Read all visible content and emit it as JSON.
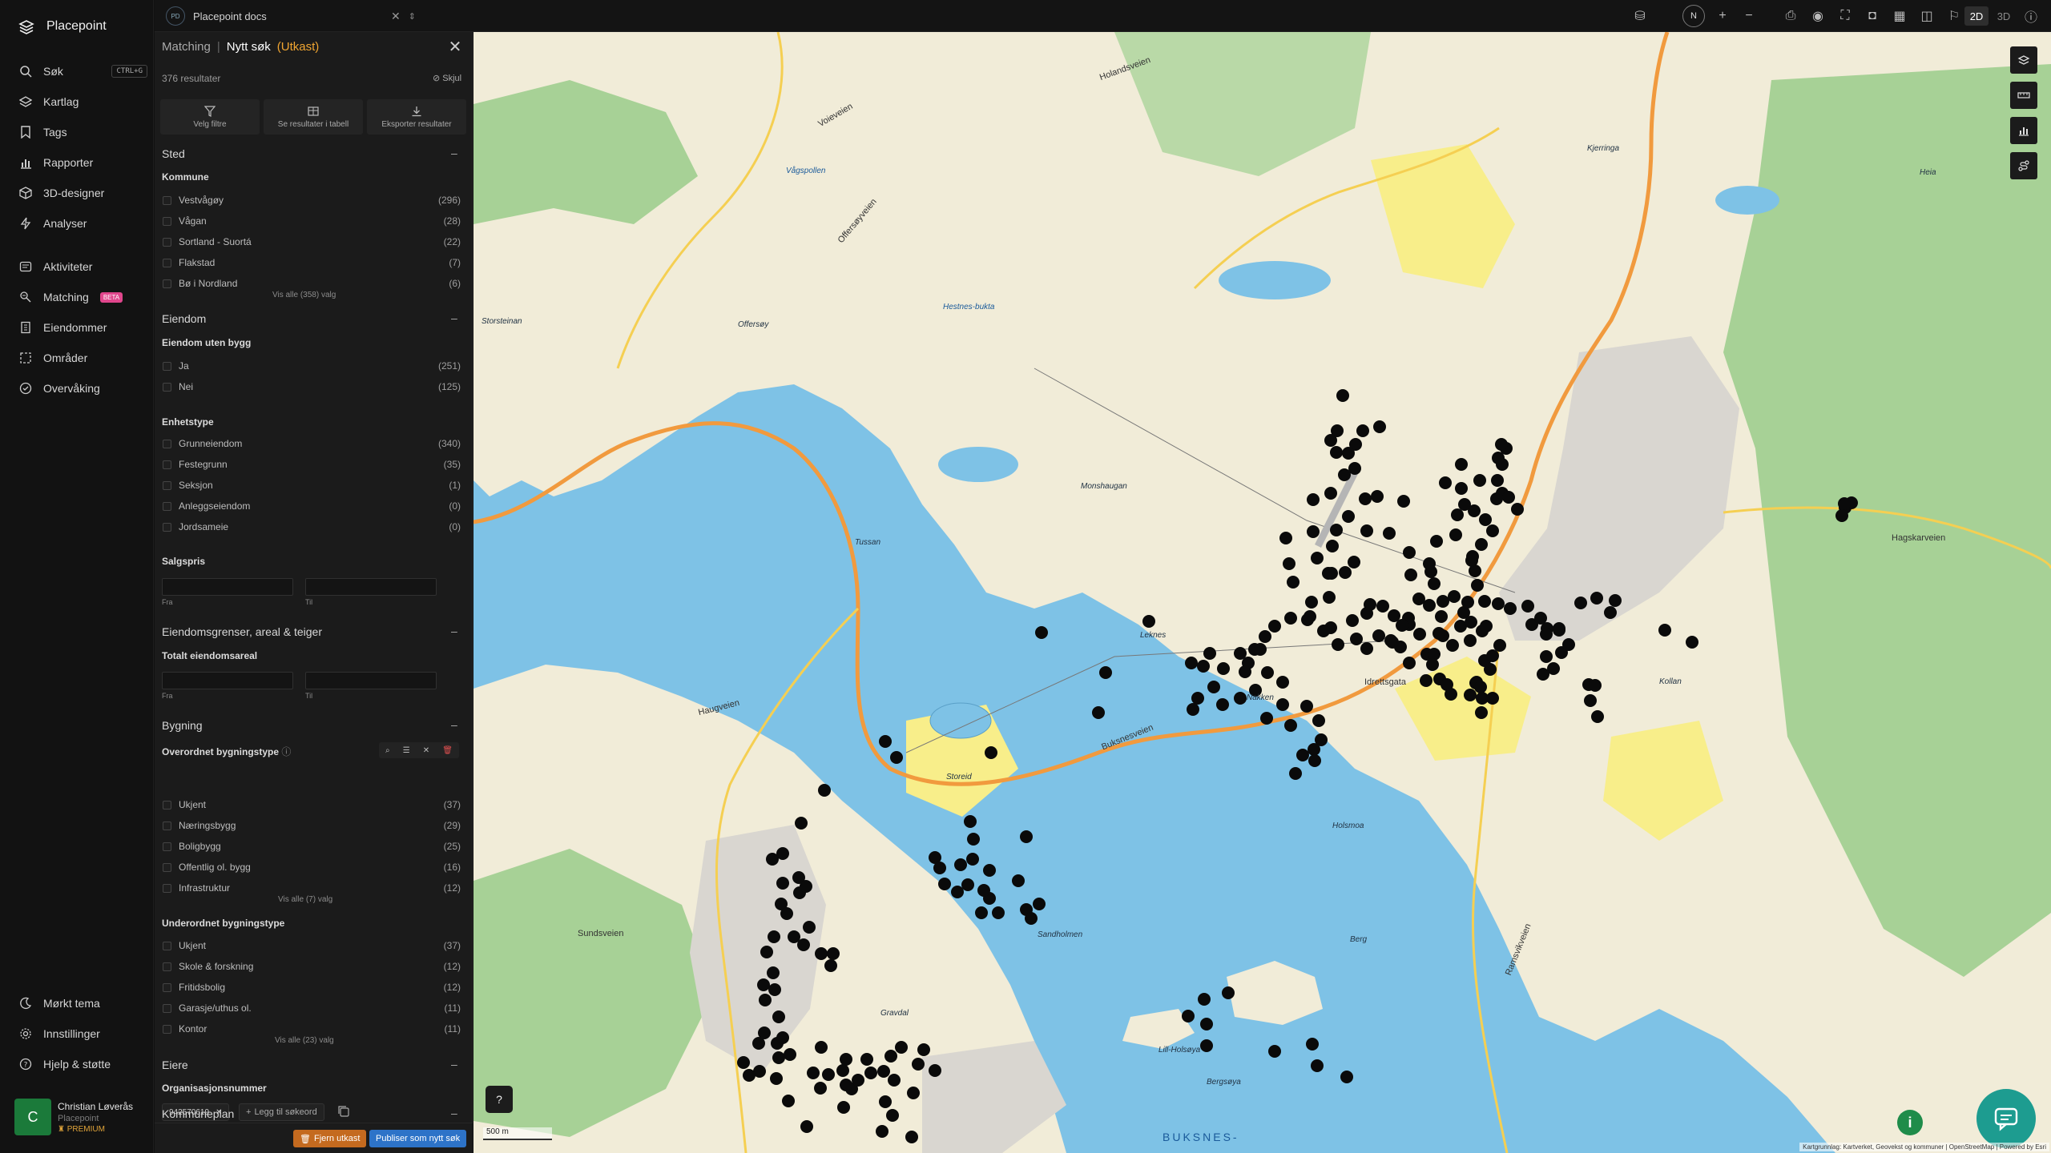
{
  "app": {
    "name": "Placepoint"
  },
  "nav": {
    "items": [
      {
        "label": "Søk",
        "shortcut": "CTRL+G"
      },
      {
        "label": "Kartlag"
      },
      {
        "label": "Tags"
      },
      {
        "label": "Rapporter"
      },
      {
        "label": "3D-designer"
      },
      {
        "label": "Analyser"
      },
      {
        "label": "Aktiviteter"
      },
      {
        "label": "Matching",
        "badge": "BETA"
      },
      {
        "label": "Eiendommer"
      },
      {
        "label": "Områder"
      },
      {
        "label": "Overvåking"
      }
    ],
    "bottom": [
      {
        "label": "Mørkt tema"
      },
      {
        "label": "Innstillinger"
      },
      {
        "label": "Hjelp & støtte"
      }
    ],
    "user": {
      "initial": "C",
      "name": "Christian Løverås",
      "org": "Placepoint",
      "plan": "PREMIUM"
    }
  },
  "topbar": {
    "doc_badge": "PD",
    "doc_name": "Placepoint docs",
    "compass": "N",
    "mode_2d": "2D",
    "mode_3d": "3D"
  },
  "panel": {
    "crumb": {
      "parent": "Matching",
      "current": "Nytt søk",
      "status": "(Utkast)"
    },
    "results": "376 resultater",
    "hide": "Skjul",
    "actions": {
      "filters": "Velg filtre",
      "table": "Se resultater i tabell",
      "export": "Eksporter resultater"
    },
    "sted": {
      "title": "Sted",
      "kommune": "Kommune",
      "rows": [
        {
          "label": "Vestvågøy",
          "count": "(296)"
        },
        {
          "label": "Vågan",
          "count": "(28)"
        },
        {
          "label": "Sortland - Suortá",
          "count": "(22)"
        },
        {
          "label": "Flakstad",
          "count": "(7)"
        },
        {
          "label": "Bø i Nordland",
          "count": "(6)"
        }
      ],
      "more": "Vis alle (358) valg"
    },
    "eiendom": {
      "title": "Eiendom",
      "uten_bygg": "Eiendom uten bygg",
      "uten_rows": [
        {
          "label": "Ja",
          "count": "(251)"
        },
        {
          "label": "Nei",
          "count": "(125)"
        }
      ],
      "enhetstype": "Enhetstype",
      "enhet_rows": [
        {
          "label": "Grunneiendom",
          "count": "(340)"
        },
        {
          "label": "Festegrunn",
          "count": "(35)"
        },
        {
          "label": "Seksjon",
          "count": "(1)"
        },
        {
          "label": "Anleggseiendom",
          "count": "(0)"
        },
        {
          "label": "Jordsameie",
          "count": "(0)"
        }
      ],
      "salgspris": "Salgspris",
      "from": "Fra",
      "to": "Til"
    },
    "grenser": {
      "title": "Eiendomsgrenser, areal & teiger",
      "total": "Totalt eiendomsareal",
      "from": "Fra",
      "to": "Til"
    },
    "bygning": {
      "title": "Bygning",
      "overordnet": "Overordnet bygningstype",
      "over_rows": [
        {
          "label": "Ukjent",
          "count": "(37)"
        },
        {
          "label": "Næringsbygg",
          "count": "(29)"
        },
        {
          "label": "Boligbygg",
          "count": "(25)"
        },
        {
          "label": "Offentlig ol. bygg",
          "count": "(16)"
        },
        {
          "label": "Infrastruktur",
          "count": "(12)"
        }
      ],
      "over_more": "Vis alle (7) valg",
      "underordnet": "Underordnet bygningstype",
      "under_rows": [
        {
          "label": "Ukjent",
          "count": "(37)"
        },
        {
          "label": "Skole & forskning",
          "count": "(12)"
        },
        {
          "label": "Fritidsbolig",
          "count": "(12)"
        },
        {
          "label": "Garasje/uthus ol.",
          "count": "(11)"
        },
        {
          "label": "Kontor",
          "count": "(11)"
        }
      ],
      "under_more": "Vis alle (23) valg"
    },
    "eiere": {
      "title": "Eiere",
      "org": "Organisasjonsnummer",
      "tag": "942570619",
      "add": "Legg til søkeord"
    },
    "kommuneplan": {
      "title": "Kommuneplan"
    },
    "footer": {
      "remove": "Fjern utkast",
      "publish": "Publiser som nytt søk"
    }
  },
  "map": {
    "scale": "500 m",
    "help": "?",
    "info": "i",
    "attribution": "Kartgrunnlag: Kartverket, Geovekst og kommuner | OpenStreetMap | Powered by Esri",
    "labels": [
      {
        "text": "Hagskarveien",
        "kind": "road"
      },
      {
        "text": "Idrettsgata",
        "kind": "road"
      },
      {
        "text": "Buksnesveien",
        "kind": "road"
      },
      {
        "text": "Haugveien",
        "kind": "road"
      },
      {
        "text": "Sundsveien",
        "kind": "road"
      },
      {
        "text": "Ramsvikveien",
        "kind": "road"
      },
      {
        "text": "Holandsveien",
        "kind": "road"
      },
      {
        "text": "Voieveien",
        "kind": "road"
      },
      {
        "text": "Offersøyveien",
        "kind": "road"
      },
      {
        "text": "BUKSNES-",
        "kind": "water"
      },
      {
        "text": "Storeid",
        "kind": "place"
      },
      {
        "text": "Monshaugan",
        "kind": "place"
      },
      {
        "text": "Leknes",
        "kind": "place"
      },
      {
        "text": "Offersøy",
        "kind": "place"
      },
      {
        "text": "Storsteinan",
        "kind": "place"
      },
      {
        "text": "Tussan",
        "kind": "place"
      },
      {
        "text": "Vågspollen",
        "kind": "water"
      },
      {
        "text": "Hestnes-bukta",
        "kind": "water"
      },
      {
        "text": "Gravdal",
        "kind": "place"
      },
      {
        "text": "Heia",
        "kind": "place"
      },
      {
        "text": "Kjerringa",
        "kind": "place"
      },
      {
        "text": "Bergsøya",
        "kind": "place"
      },
      {
        "text": "Lill-Holsøya",
        "kind": "place"
      },
      {
        "text": "Sandholmen",
        "kind": "place"
      },
      {
        "text": "Nakken",
        "kind": "place"
      },
      {
        "text": "Kollan",
        "kind": "place"
      },
      {
        "text": "Berg",
        "kind": "place"
      },
      {
        "text": "Holsmoa",
        "kind": "place"
      }
    ]
  }
}
